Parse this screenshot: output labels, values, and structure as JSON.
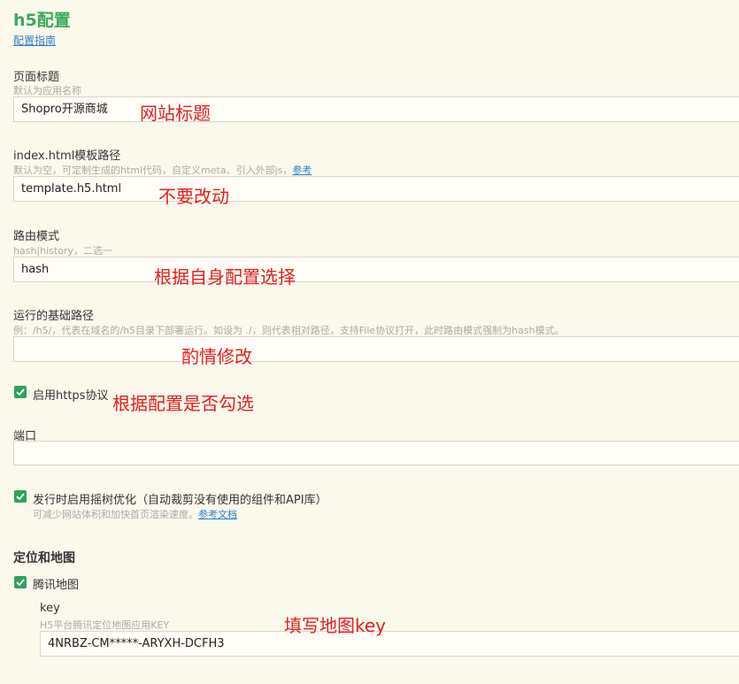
{
  "page": {
    "title": "h5配置",
    "guide_link": "配置指南"
  },
  "page_title_field": {
    "label": "页面标题",
    "hint": "默认为应用名称",
    "value": "Shopro开源商城",
    "annotation": "网站标题"
  },
  "template_field": {
    "label": "index.html模板路径",
    "hint": "默认为空，可定制生成的html代码，自定义meta、引入外部js，",
    "hint_link": "参考",
    "value": "template.h5.html",
    "annotation": "不要改动"
  },
  "router_field": {
    "label": "路由模式",
    "hint": "hash|history，二选一",
    "value": "hash",
    "annotation": "根据自身配置选择"
  },
  "base_path_field": {
    "label": "运行的基础路径",
    "hint": "例：/h5/，代表在域名的/h5目录下部署运行。如设为 ./，则代表相对路径，支持File协议打开，此时路由模式强制为hash模式。",
    "value": "",
    "annotation": "酌情修改"
  },
  "https_option": {
    "checked": true,
    "label": "启用https协议",
    "annotation": "根据配置是否勾选"
  },
  "port_field": {
    "label": "端口",
    "value": ""
  },
  "tree_shaking_option": {
    "checked": true,
    "label": "发行时启用摇树优化（自动裁剪没有使用的组件和API库）",
    "hint": "可减少网站体积和加快首页渲染速度。",
    "hint_link": "参考文档"
  },
  "location_section": {
    "title": "定位和地图",
    "tencent_map": {
      "checked": true,
      "label": "腾讯地图"
    },
    "key_field": {
      "label": "key",
      "hint": "H5平台腾讯定位地图应用KEY",
      "value": "4NRBZ-CM*****-ARYXH-DCFH3",
      "annotation": "填写地图key"
    }
  },
  "colors": {
    "background": "#fbf8ec",
    "title_green": "#3aaa5c",
    "link_blue": "#2e80c4",
    "annotation_red": "#e02020",
    "checkbox_green": "#2ea35a"
  }
}
